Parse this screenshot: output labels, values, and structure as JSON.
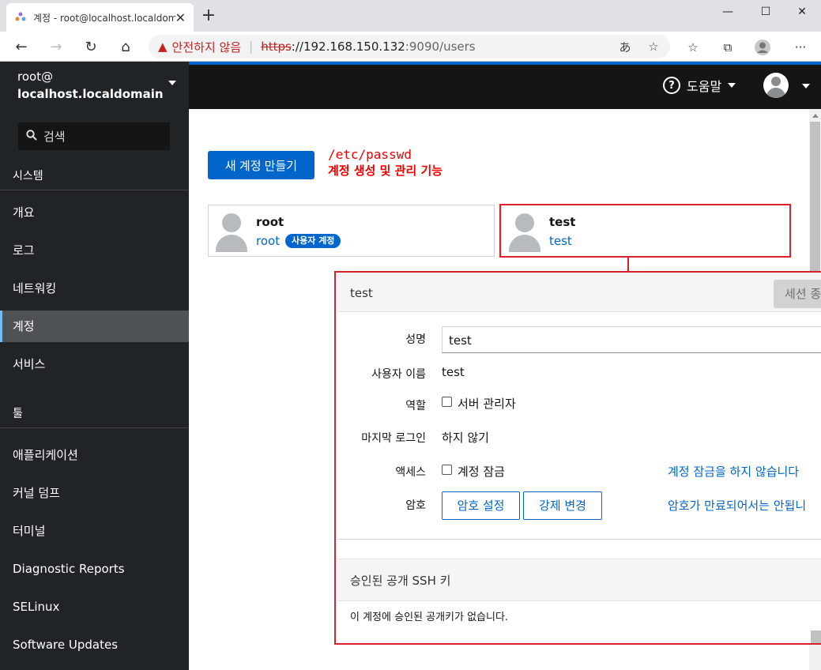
{
  "browser": {
    "tab_title": "계정 - root@localhost.localdomain",
    "tab_close": "✕",
    "new_tab": "+",
    "warning_text": "안전하지 않음",
    "url_protocol": "https",
    "url_host": "://192.168.150.132",
    "url_path": ":9090/users",
    "win_min": "—",
    "win_max": "☐",
    "win_close": "✕",
    "more": "···"
  },
  "sidebar": {
    "user": "root@",
    "host": "localhost.localdomain",
    "search_placeholder": "검색",
    "section_system": "시스템",
    "items_system": [
      "개요",
      "로그",
      "네트워킹",
      "계정",
      "서비스"
    ],
    "active_item": "계정",
    "section_tools": "툴",
    "items_tools": [
      "애플리케이션",
      "커널 덤프",
      "터미널",
      "Diagnostic Reports",
      "SELinux",
      "Software Updates"
    ]
  },
  "topbar": {
    "help_label": "도움말"
  },
  "accounts": {
    "new_account_button": "새 계정 만들기",
    "annotation_line1": "/etc/passwd",
    "annotation_line2": "계정 생성 및 관리 기능",
    "cards": [
      {
        "name": "root",
        "login": "root",
        "badge": "사용자 계정"
      },
      {
        "name": "test",
        "login": "test"
      }
    ]
  },
  "detail": {
    "title": "test",
    "end_session_button": "세션 종",
    "fullname_label": "성명",
    "fullname_value": "test",
    "username_label": "사용자 이름",
    "username_value": "test",
    "role_label": "역할",
    "role_option": "서버 관리자",
    "last_login_label": "마지막 로그인",
    "last_login_value": "하지 않기",
    "access_label": "액세스",
    "access_option": "계정 잠금",
    "access_link": "계정 잠금을 하지 않습니다",
    "password_label": "암호",
    "set_password_button": "암호 설정",
    "force_change_button": "강제 변경",
    "password_link": "암호가 만료되어서는 안됩니",
    "ssh_title": "승인된 공개 SSH 키",
    "ssh_empty": "이 계정에 승인된 공개키가 없습니다."
  },
  "colors": {
    "accent": "#0066cc",
    "annotation": "#d8202f",
    "sidebar_bg": "#212427",
    "topbar_bg": "#151515"
  }
}
